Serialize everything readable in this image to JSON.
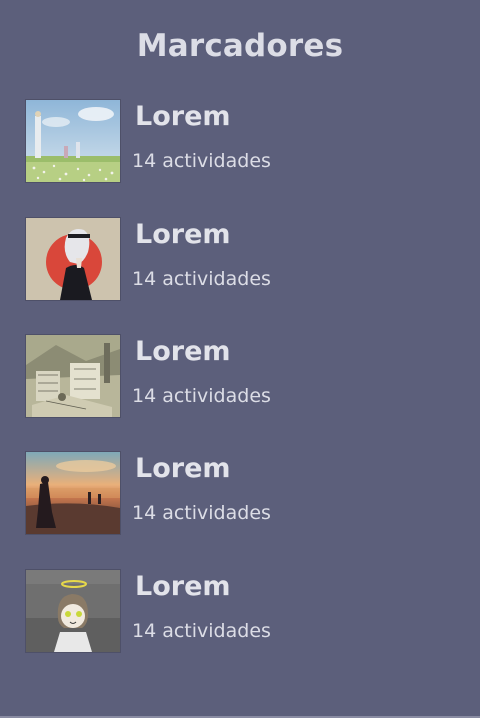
{
  "header": {
    "title": "Marcadores"
  },
  "bookmarks": [
    {
      "title": "Lorem",
      "count": "14 actividades",
      "thumbnail": "field-landscape"
    },
    {
      "title": "Lorem",
      "count": "14 actividades",
      "thumbnail": "portrait-red-sun"
    },
    {
      "title": "Lorem",
      "count": "14 actividades",
      "thumbnail": "ruins-sketch"
    },
    {
      "title": "Lorem",
      "count": "14 actividades",
      "thumbnail": "sunset-beach"
    },
    {
      "title": "Lorem",
      "count": "14 actividades",
      "thumbnail": "halo-character"
    }
  ],
  "colors": {
    "background": "#5c5f7b",
    "text": "#dcdde6"
  }
}
